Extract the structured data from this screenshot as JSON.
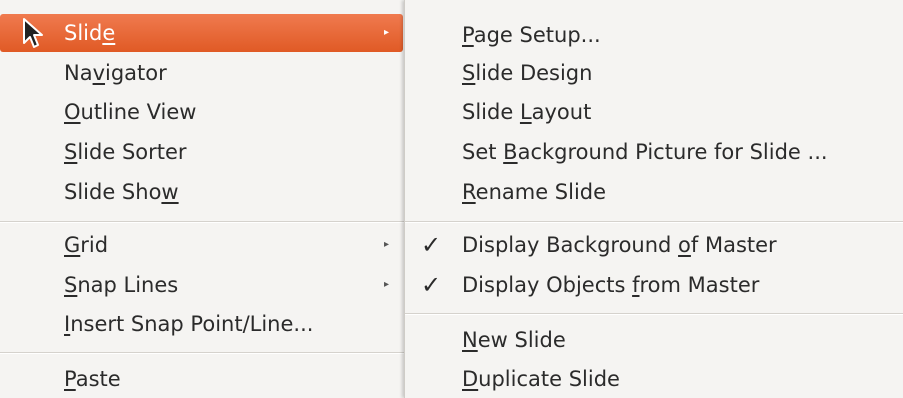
{
  "context_menu": {
    "items": [
      {
        "pre": "Slid",
        "key": "e",
        "post": ""
      },
      {
        "pre": "Na",
        "key": "v",
        "post": "igator"
      },
      {
        "pre": "",
        "key": "O",
        "post": "utline View"
      },
      {
        "pre": "",
        "key": "S",
        "post": "lide Sorter"
      },
      {
        "pre": "Slide Sho",
        "key": "w",
        "post": ""
      },
      {
        "pre": "",
        "key": "G",
        "post": "rid"
      },
      {
        "pre": "",
        "key": "S",
        "post": "nap Lines"
      },
      {
        "pre": "",
        "key": "I",
        "post": "nsert Snap Point/Line..."
      },
      {
        "pre": "",
        "key": "P",
        "post": "aste"
      }
    ]
  },
  "slide_submenu": {
    "items": [
      {
        "pre": "",
        "key": "P",
        "post": "age Setup..."
      },
      {
        "pre": "",
        "key": "S",
        "post": "lide Design"
      },
      {
        "pre": "Slide ",
        "key": "L",
        "post": "ayout"
      },
      {
        "pre": "Set ",
        "key": "B",
        "post": "ackground Picture for Slide ..."
      },
      {
        "pre": "",
        "key": "R",
        "post": "ename Slide"
      },
      {
        "pre": "Display Background ",
        "key": "o",
        "post": "f Master"
      },
      {
        "pre": "Display Objects ",
        "key": "f",
        "post": "rom Master"
      },
      {
        "pre": "",
        "key": "N",
        "post": "ew Slide"
      },
      {
        "pre": "",
        "key": "D",
        "post": "uplicate Slide"
      }
    ]
  },
  "icons": {
    "submenu_arrow": "▸",
    "check": "✓",
    "cursor": "mouse-pointer-icon"
  },
  "colors": {
    "highlight": "#e95420",
    "menu_bg": "#f5f4f2",
    "text": "#2b2b2b"
  }
}
